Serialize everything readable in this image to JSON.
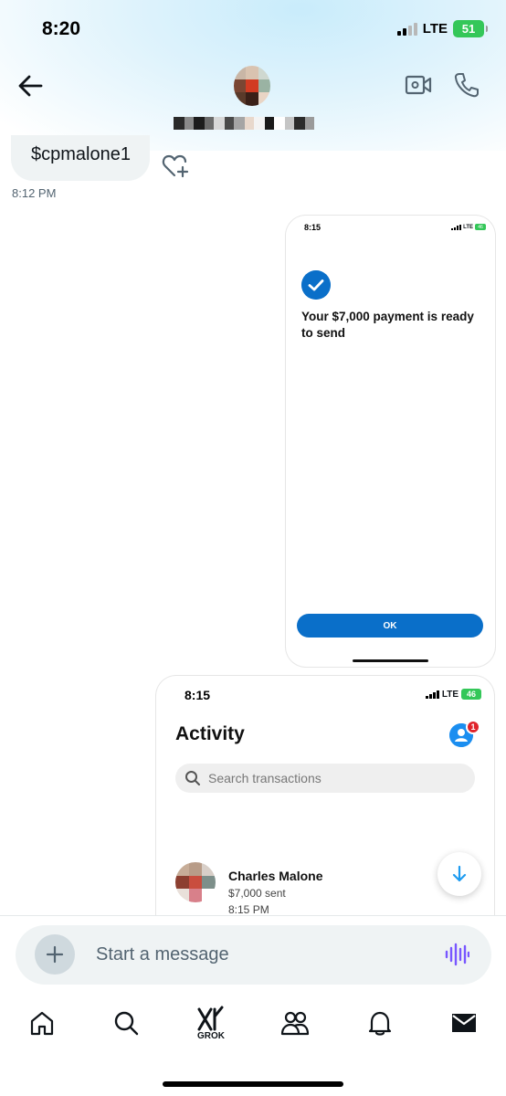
{
  "status_bar": {
    "time": "8:20",
    "network": "LTE",
    "battery": "51"
  },
  "header": {
    "back_label": "back",
    "contact_name_hidden": true
  },
  "chat": {
    "message_text": "$cpmalone1",
    "message_time": "8:12 PM"
  },
  "screenshot1": {
    "status_time": "8:15",
    "network": "LTE",
    "battery": "46",
    "message": "Your $7,000 payment is ready to send",
    "ok_label": "OK"
  },
  "screenshot2": {
    "status_time": "8:15",
    "network": "LTE",
    "battery": "46",
    "title": "Activity",
    "badge_count": "1",
    "search_placeholder": "Search transactions",
    "transaction": {
      "name": "Charles Malone",
      "amount": "$7,000 sent",
      "time": "8:15 PM"
    }
  },
  "composer": {
    "placeholder": "Start a message"
  },
  "nav": {
    "grok_label": "GROK"
  },
  "colors": {
    "accent": "#0a6fc9",
    "voice": "#7856ff",
    "battery": "#34c759",
    "badge": "#e0242b"
  }
}
